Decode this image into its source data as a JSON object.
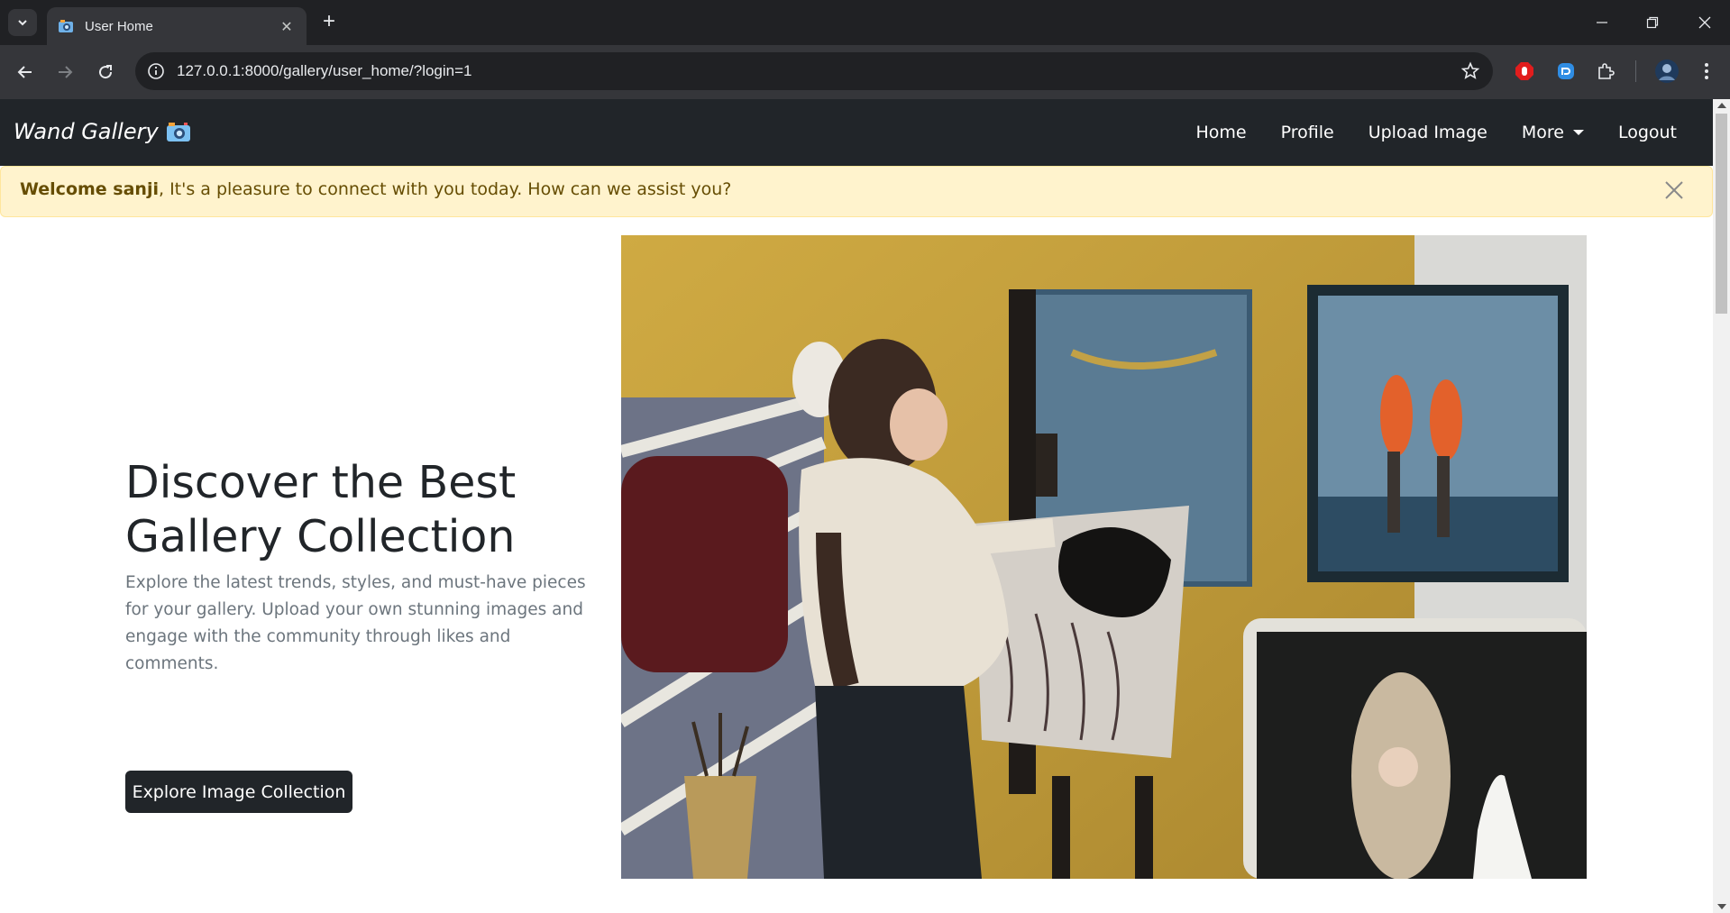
{
  "browser": {
    "tab": {
      "title": "User Home"
    },
    "address_bar": {
      "url": "127.0.0.1:8000/gallery/user_home/?login=1"
    }
  },
  "site": {
    "brand": "Wand Gallery",
    "nav": [
      {
        "label": "Home"
      },
      {
        "label": "Profile"
      },
      {
        "label": "Upload Image"
      },
      {
        "label": "More"
      },
      {
        "label": "Logout"
      }
    ],
    "alert": {
      "bold": "Welcome sanji",
      "text": ", It's a pleasure to connect with you today. How can we assist you?"
    },
    "hero": {
      "title": "Discover the Best Gallery Collection",
      "lead": "Explore the latest trends, styles, and must-have pieces for your gallery. Upload your own stunning images and engage with the community through likes and comments.",
      "button": "Explore Image Collection",
      "image": "artist-painting-studio-photo"
    }
  },
  "colors": {
    "navbar_bg": "#212529",
    "alert_bg": "#fff3cd",
    "alert_text": "#664d03",
    "button_bg": "#212529",
    "chrome_bg": "#202124",
    "toolbar_bg": "#35363a"
  }
}
